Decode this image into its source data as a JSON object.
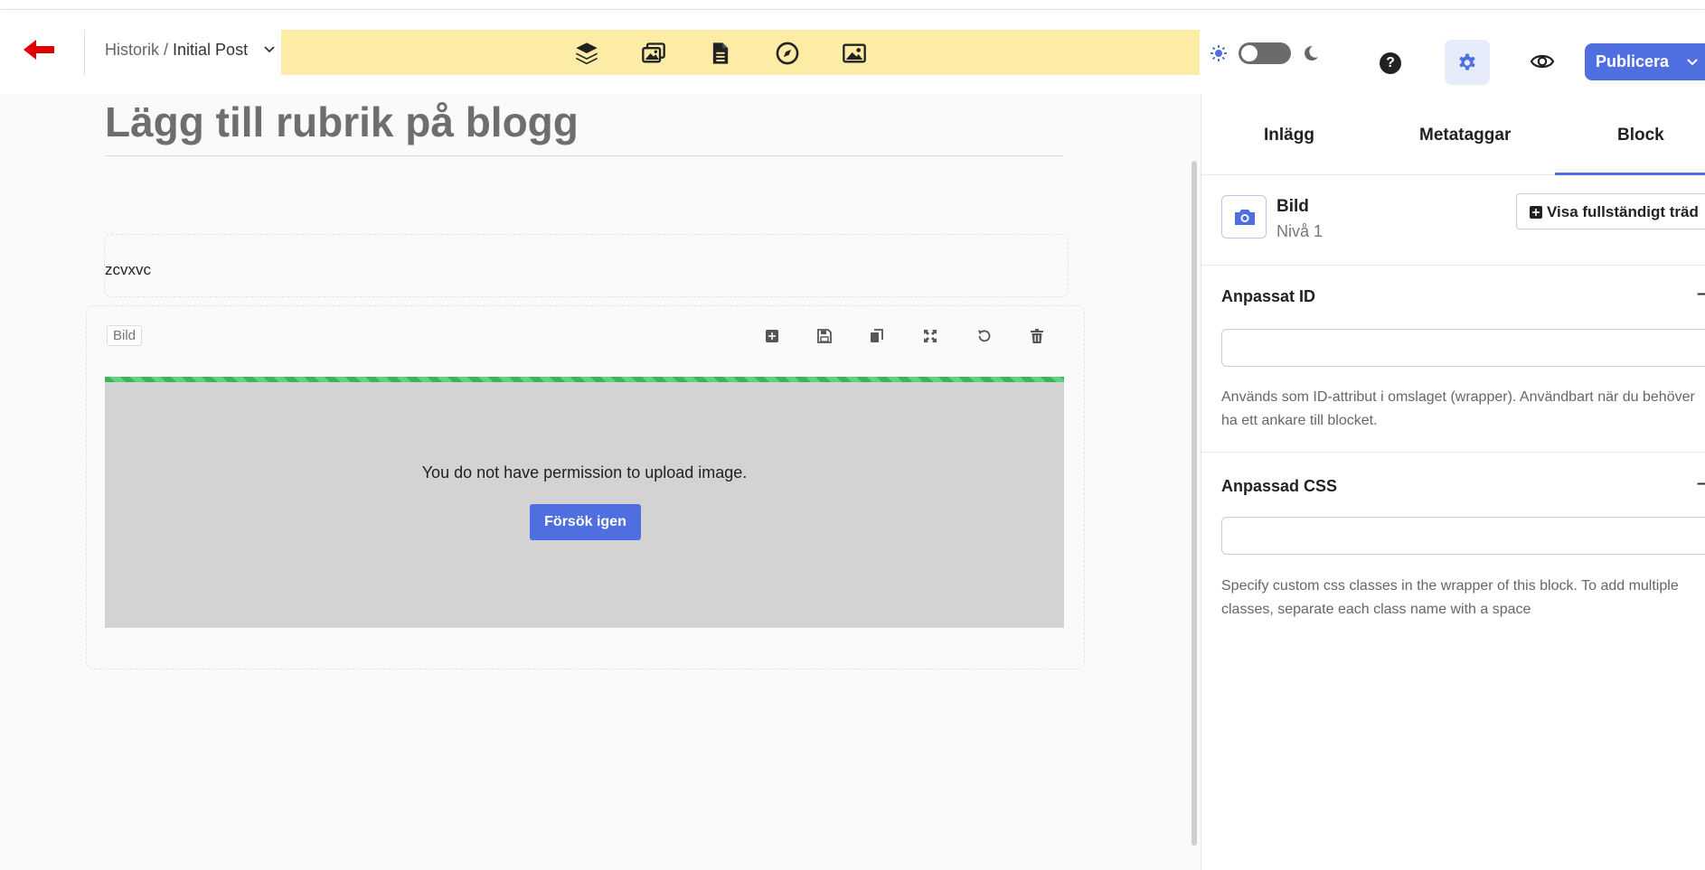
{
  "header": {
    "breadcrumb_parent": "Historik",
    "breadcrumb_separator": " / ",
    "breadcrumb_current": "Initial Post",
    "publish_label": "Publicera",
    "help_label": "?"
  },
  "toolbar": {
    "icons": [
      "layers-icon",
      "gallery-icon",
      "document-icon",
      "compass-icon",
      "image-icon"
    ]
  },
  "editor": {
    "post_title": "Lägg till rubrik på blogg",
    "text_block_content": "zcvxvc",
    "image_block": {
      "label": "Bild",
      "upload_message": "You do not have permission to upload image.",
      "retry_label": "Försök igen",
      "upload_progress": 1.0
    }
  },
  "sidebar": {
    "tabs": [
      {
        "label": "Inlägg"
      },
      {
        "label": "Metataggar"
      },
      {
        "label": "Block"
      }
    ],
    "active_tab": "Block",
    "block": {
      "name": "Bild",
      "level": "Nivå 1",
      "tree_button": "Visa fullständigt träd"
    },
    "custom_id": {
      "title": "Anpassat ID",
      "value": "",
      "help": "Används som ID-attribut i omslaget (wrapper). Användbart när du behöver ha ett ankare till blocket."
    },
    "custom_css": {
      "title": "Anpassad CSS",
      "value": "",
      "help": "Specify custom css classes in the wrapper of this block. To add multiple classes, separate each class name with a space"
    }
  },
  "colors": {
    "accent": "#4f6fe0",
    "back_arrow": "#e00000",
    "toolbar_bg": "#fdeca6",
    "progress": "#3db35a",
    "upload_bg": "#d3d3d3"
  }
}
